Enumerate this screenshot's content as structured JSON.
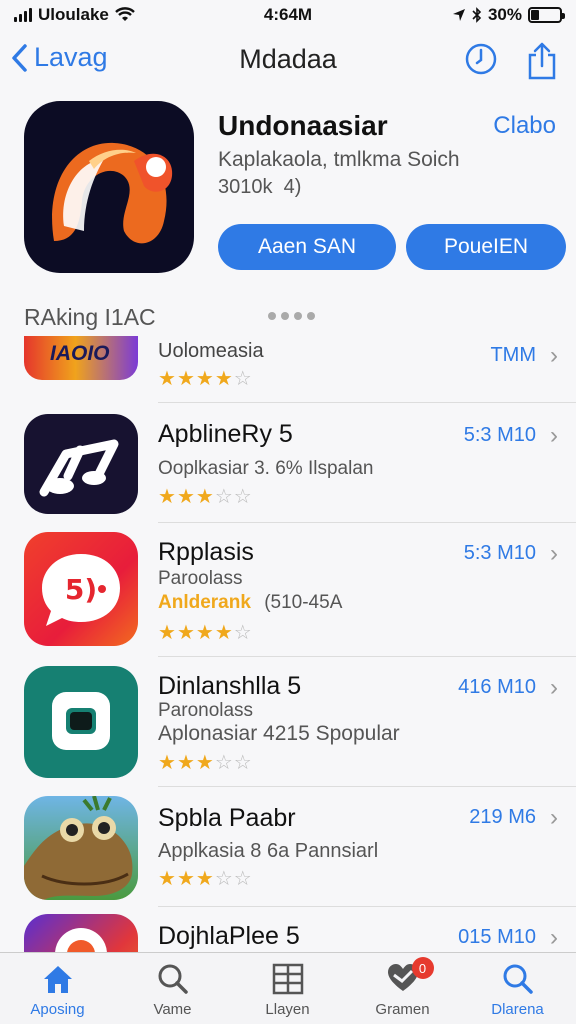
{
  "status_bar": {
    "carrier": "Uloulake",
    "time": "4:64M",
    "battery": "30%",
    "battery_level": 0.3
  },
  "nav": {
    "back_label": "Lavag",
    "title": "Mdadaa",
    "icons": [
      "clock-icon",
      "share-icon"
    ]
  },
  "hero": {
    "app_name": "Undonaasiar",
    "open_label": "Clabo",
    "subtitle": "Kaplakaola, tmlkma Soich",
    "subtitle2": "3010k  4)",
    "button_primary": "Aaen SAN",
    "button_secondary": "PoueIEN"
  },
  "section": {
    "title": "RAking I1AC"
  },
  "apps": [
    {
      "title": "Uolomeasia",
      "size": "TMM",
      "rating": 4,
      "banner_text": "IAOIO",
      "lines": []
    },
    {
      "title": "ApblineRy 5",
      "size": "5:3 M10",
      "rating": 3,
      "lines": [
        "Ooplkasiar 3. 6% Ilspalan"
      ]
    },
    {
      "title": "Rpplasis",
      "size": "5:3 M10",
      "rating": 4,
      "lines": [
        "Paroolass"
      ],
      "highlight": "Anlderank",
      "highlight_extra": "(510-45A"
    },
    {
      "title": "Dinlanshlla 5",
      "size": "416 M10",
      "rating": 3,
      "lines": [
        "Paronolass",
        "Aplonasiar 4215 Spopular"
      ]
    },
    {
      "title": "Spbla Paabr",
      "size": "219 M6",
      "rating": 3,
      "lines": [
        "Applkasia 8 6a Pannsiarl"
      ]
    },
    {
      "title": "DojhlaPlee 5",
      "size": "015 M10",
      "rating": 0,
      "lines": []
    }
  ],
  "tabs": [
    {
      "label": "Aposing",
      "icon": "home-icon",
      "active": true
    },
    {
      "label": "Vame",
      "icon": "search-icon",
      "active": false
    },
    {
      "label": "Llayen",
      "icon": "grid-icon",
      "active": false
    },
    {
      "label": "Gramen",
      "icon": "heart-chat-icon",
      "active": false,
      "badge": "0"
    },
    {
      "label": "Dlarena",
      "icon": "search-icon",
      "active": false
    }
  ],
  "colors": {
    "accent": "#2f7ae5",
    "star": "#f0a81c",
    "badge": "#e63a2e"
  }
}
